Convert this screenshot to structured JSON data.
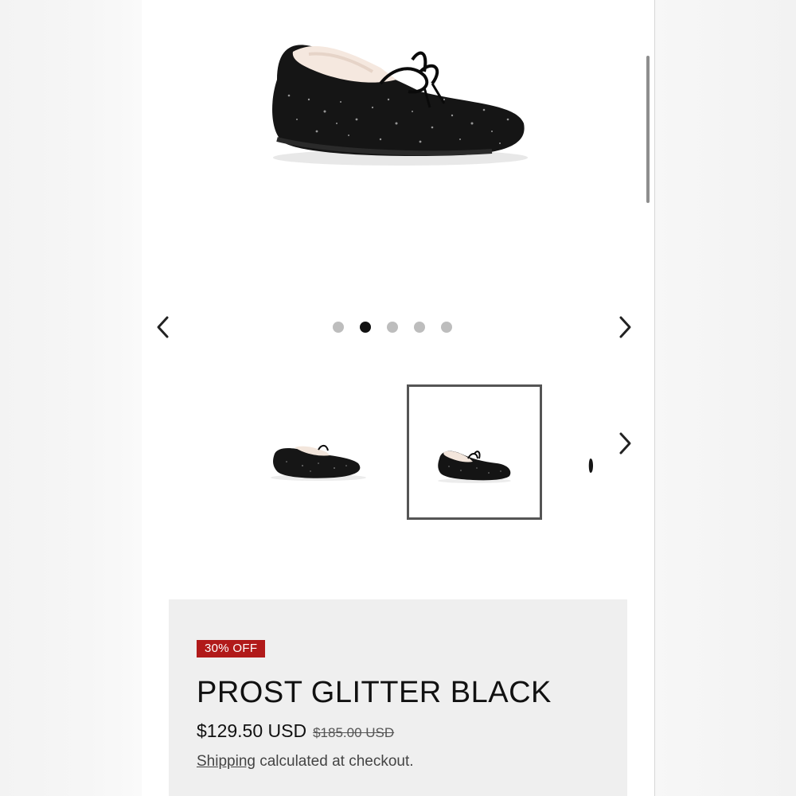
{
  "gallery": {
    "images": [
      "Prost Glitter Black moccasin - side view",
      "Prost Glitter Black moccasin - angled view",
      "Prost Glitter Black moccasin - alternate view"
    ],
    "dot_count": 5,
    "active_dot": 2,
    "prev_icon": "chevron-left-icon",
    "next_icon": "chevron-right-icon"
  },
  "product": {
    "badge": "30% OFF",
    "title": "PROST GLITTER BLACK",
    "price": "$129.50 USD",
    "compare_price": "$185.00 USD",
    "shipping_link": "Shipping",
    "shipping_suffix": " calculated at checkout."
  },
  "colors": {
    "badge_bg": "#b11a1a",
    "panel_bg": "#efefef"
  }
}
